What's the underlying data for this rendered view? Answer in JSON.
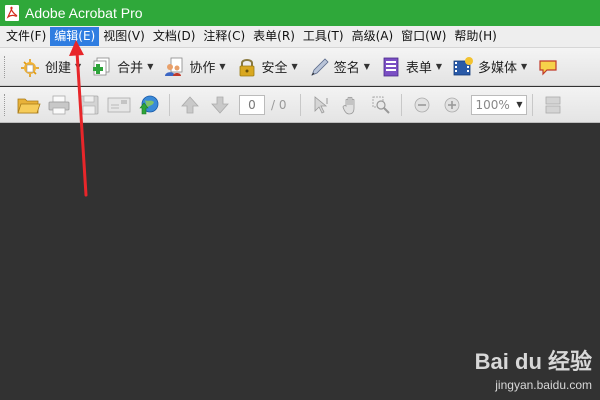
{
  "window": {
    "title": "Adobe Acrobat Pro",
    "title_bar_color": "#2fa83a"
  },
  "menubar": {
    "items": [
      {
        "label": "文件(F)",
        "active": false
      },
      {
        "label": "编辑(E)",
        "active": true
      },
      {
        "label": "视图(V)",
        "active": false
      },
      {
        "label": "文档(D)",
        "active": false
      },
      {
        "label": "注释(C)",
        "active": false
      },
      {
        "label": "表单(R)",
        "active": false
      },
      {
        "label": "工具(T)",
        "active": false
      },
      {
        "label": "高级(A)",
        "active": false
      },
      {
        "label": "窗口(W)",
        "active": false
      },
      {
        "label": "帮助(H)",
        "active": false
      }
    ],
    "active_color": "#2f7de1"
  },
  "task_toolbar": {
    "buttons": [
      {
        "label": "创建",
        "icon": "create-pdf-icon"
      },
      {
        "label": "合并",
        "icon": "combine-icon"
      },
      {
        "label": "协作",
        "icon": "collaborate-icon"
      },
      {
        "label": "安全",
        "icon": "lock-icon"
      },
      {
        "label": "签名",
        "icon": "pen-icon"
      },
      {
        "label": "表单",
        "icon": "form-icon"
      },
      {
        "label": "多媒体",
        "icon": "film-icon"
      }
    ]
  },
  "tools_toolbar": {
    "current_page": "0",
    "total_pages": "/ 0",
    "zoom": "100%"
  },
  "watermark": {
    "logo_text": "Bai du 经验",
    "url": "jingyan.baidu.com"
  },
  "annotation": {
    "arrow_color": "#e8262a"
  }
}
